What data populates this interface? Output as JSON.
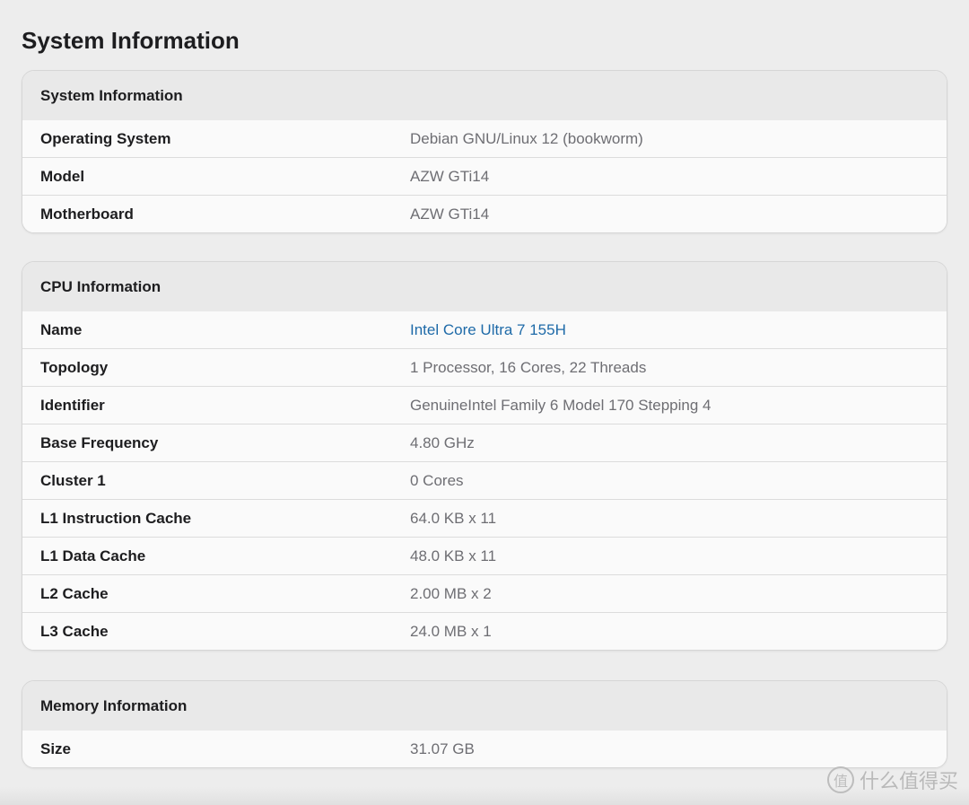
{
  "page": {
    "title": "System Information"
  },
  "system": {
    "header": "System Information",
    "rows": [
      {
        "key": "Operating System",
        "value": "Debian GNU/Linux 12 (bookworm)"
      },
      {
        "key": "Model",
        "value": "AZW GTi14"
      },
      {
        "key": "Motherboard",
        "value": "AZW GTi14"
      }
    ]
  },
  "cpu": {
    "header": "CPU Information",
    "rows": [
      {
        "key": "Name",
        "value": "Intel Core Ultra 7 155H"
      },
      {
        "key": "Topology",
        "value": "1 Processor, 16 Cores, 22 Threads"
      },
      {
        "key": "Identifier",
        "value": "GenuineIntel Family 6 Model 170 Stepping 4"
      },
      {
        "key": "Base Frequency",
        "value": "4.80 GHz"
      },
      {
        "key": "Cluster 1",
        "value": "0 Cores"
      },
      {
        "key": "L1 Instruction Cache",
        "value": "64.0 KB x 11"
      },
      {
        "key": "L1 Data Cache",
        "value": "48.0 KB x 11"
      },
      {
        "key": "L2 Cache",
        "value": "2.00 MB x 2"
      },
      {
        "key": "L3 Cache",
        "value": "24.0 MB x 1"
      }
    ]
  },
  "memory": {
    "header": "Memory Information",
    "rows": [
      {
        "key": "Size",
        "value": "31.07 GB"
      }
    ]
  },
  "watermark": {
    "icon": "zhi-logo-icon",
    "logo_glyph": "值",
    "text": "什么值得买"
  },
  "colors": {
    "link": "#1e6aa8",
    "background": "#ededed",
    "header_bg": "#e9e9e9"
  }
}
